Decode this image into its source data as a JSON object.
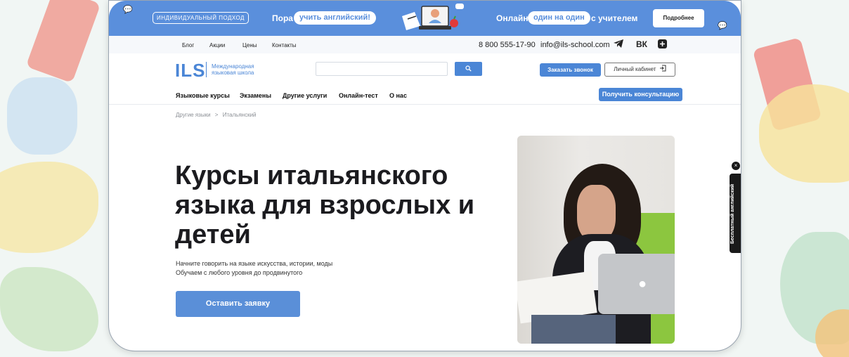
{
  "promo": {
    "badge": "ИНДИВИДУАЛЬНЫЙ ПОДХОД",
    "text_left": "Пора",
    "pill_left": "учить английский!",
    "text_right_prefix": "Онлайн",
    "pill_right": "один на один",
    "text_right_suffix": "с учителем",
    "more_label": "Подробнее",
    "bg_color": "#5a8fdc"
  },
  "topbar": {
    "links": [
      "Блог",
      "Акции",
      "Цены",
      "Контакты"
    ],
    "phone": "8 800 555-17-90",
    "email": "info@ils-school.com",
    "social_icons": [
      "telegram-icon",
      "vk-icon",
      "plus-icon"
    ]
  },
  "header": {
    "logo": "ILS",
    "logo_sub_line1": "Международная",
    "logo_sub_line2": "языковая школа",
    "search_placeholder": "",
    "search_icon": "search-icon",
    "call_label": "Заказать звонок",
    "cabinet_label": "Личный кабинет",
    "accent_color": "#4b86d6"
  },
  "nav": {
    "items": [
      "Языковые курсы",
      "Экзамены",
      "Другие услуги",
      "Онлайн-тест",
      "О нас"
    ],
    "consult_label": "Получить консультацию"
  },
  "breadcrumb": {
    "parent": "Другие языки",
    "separator": ">",
    "current": "Итальянский"
  },
  "hero": {
    "title": "Курсы итальянского языка для взрослых и детей",
    "sub_line1": "Начните говорить на языке искусства, истории, моды",
    "sub_line2": "Обучаем с любого уровня до продвинутого",
    "cta_label": "Оставить заявку"
  },
  "side_tab": {
    "label": "Бесплатный английский",
    "close": "×"
  }
}
